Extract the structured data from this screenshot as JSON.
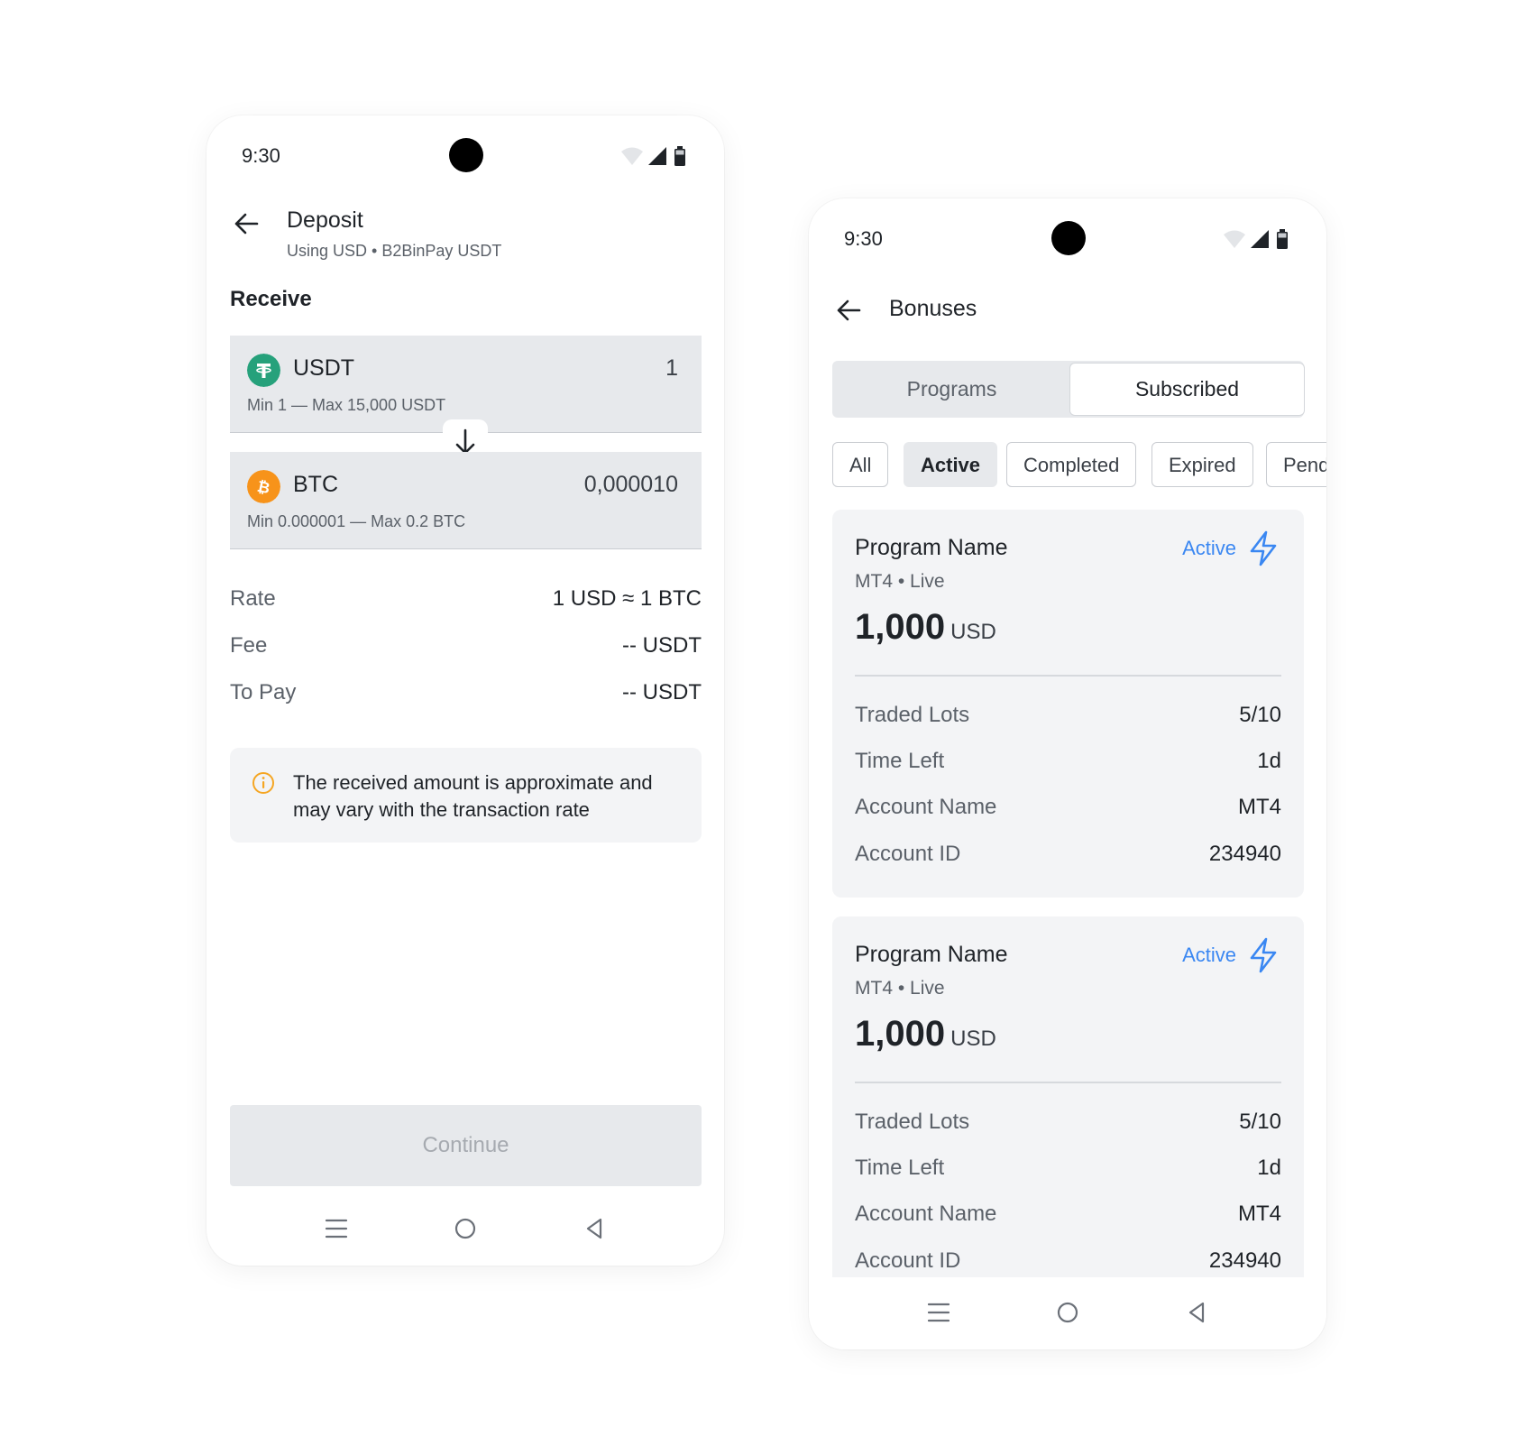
{
  "deposit_screen": {
    "status": {
      "time": "9:30"
    },
    "header": {
      "title": "Deposit",
      "subtitle": "Using USD • B2BinPay USDT"
    },
    "section_label": "Receive",
    "from_coin": {
      "name": "USDT",
      "amount": "1",
      "limits": "Min 1 — Max 15,000 USDT",
      "icon": "tether-icon",
      "color": "#26a17b"
    },
    "to_coin": {
      "name": "BTC",
      "amount": "0,000010",
      "limits": "Min 0.000001 — Max 0.2 BTC",
      "icon": "bitcoin-icon",
      "color": "#f7931a"
    },
    "rows": [
      {
        "label": "Rate",
        "value": "1 USD ≈ 1 BTC"
      },
      {
        "label": "Fee",
        "value": "-- USDT"
      },
      {
        "label": "To Pay",
        "value": "-- USDT"
      }
    ],
    "notice": {
      "text": "The received amount is approximate and may vary with the transaction rate",
      "icon": "info-icon",
      "color": "#f5a623"
    },
    "continue_label": "Continue"
  },
  "bonuses_screen": {
    "status": {
      "time": "9:30"
    },
    "header": {
      "title": "Bonuses"
    },
    "tabs": [
      {
        "label": "Programs",
        "selected": false
      },
      {
        "label": "Subscribed",
        "selected": true
      }
    ],
    "filters": [
      {
        "label": "All",
        "selected": false
      },
      {
        "label": "Active",
        "selected": true
      },
      {
        "label": "Completed",
        "selected": false
      },
      {
        "label": "Expired",
        "selected": false
      },
      {
        "label": "Pend",
        "selected": false
      }
    ],
    "cards": [
      {
        "title": "Program Name",
        "subtitle": "MT4 • Live",
        "status": "Active",
        "amount": "1,000",
        "currency": "USD",
        "rows": [
          {
            "label": "Traded Lots",
            "value": "5/10"
          },
          {
            "label": "Time Left",
            "value": "1d"
          },
          {
            "label": "Account Name",
            "value": "MT4"
          },
          {
            "label": "Account ID",
            "value": "234940"
          }
        ]
      },
      {
        "title": "Program Name",
        "subtitle": "MT4 • Live",
        "status": "Active",
        "amount": "1,000",
        "currency": "USD",
        "rows": [
          {
            "label": "Traded Lots",
            "value": "5/10"
          },
          {
            "label": "Time Left",
            "value": "1d"
          },
          {
            "label": "Account Name",
            "value": "MT4"
          },
          {
            "label": "Account ID",
            "value": "234940"
          }
        ]
      }
    ],
    "accent_color": "#3a87f2"
  }
}
